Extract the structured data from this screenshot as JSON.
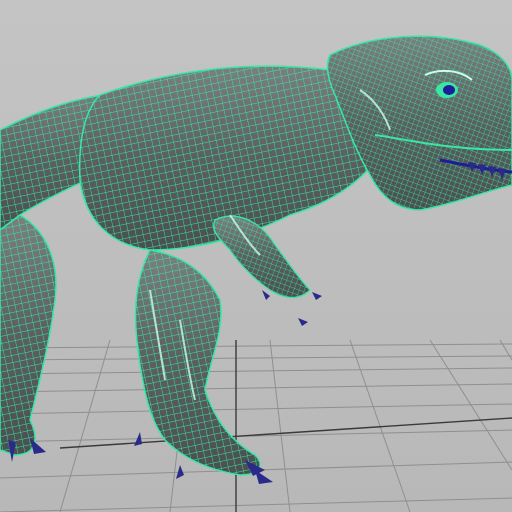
{
  "viewport": {
    "background": "#bdbdbd",
    "grid_color": "#8f8f8f",
    "grid_axis_color": "#3a3a3a"
  },
  "model": {
    "name": "",
    "display_mode": "wireframe-on-shaded",
    "shaded_color": "#5f6464",
    "wire_color": "#39e6a4",
    "highlight_color": "#c8ffe6",
    "claw_color": "#2a2a8a",
    "eye_color": "#1e1e9a"
  }
}
